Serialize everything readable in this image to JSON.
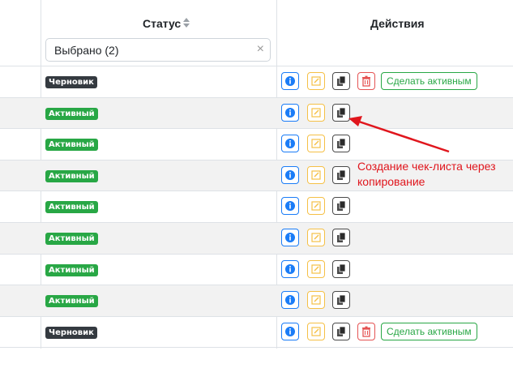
{
  "header": {
    "status_label": "Статус",
    "actions_label": "Действия",
    "sort_icon": "sort-icon"
  },
  "filter": {
    "value": "Выбрано (2)",
    "clear_icon": "×"
  },
  "rows": [
    {
      "status": "Черновик",
      "status_type": "draft",
      "has_delete": true,
      "activate_label": "Сделать активным"
    },
    {
      "status": "Активный",
      "status_type": "active",
      "has_delete": false
    },
    {
      "status": "Активный",
      "status_type": "active",
      "has_delete": false
    },
    {
      "status": "Активный",
      "status_type": "active",
      "has_delete": false
    },
    {
      "status": "Активный",
      "status_type": "active",
      "has_delete": false
    },
    {
      "status": "Активный",
      "status_type": "active",
      "has_delete": false
    },
    {
      "status": "Активный",
      "status_type": "active",
      "has_delete": false
    },
    {
      "status": "Активный",
      "status_type": "active",
      "has_delete": false
    },
    {
      "status": "Черновик",
      "status_type": "draft",
      "has_delete": true,
      "activate_label": "Сделать активным"
    }
  ],
  "annotation": {
    "text": "Создание чек-листа через копирование"
  },
  "colors": {
    "draft_badge": "#343a40",
    "active_badge": "#28a745",
    "info": "#1a7cf7",
    "edit": "#f5c046",
    "delete": "#e55353",
    "annotation": "#e0161d"
  }
}
